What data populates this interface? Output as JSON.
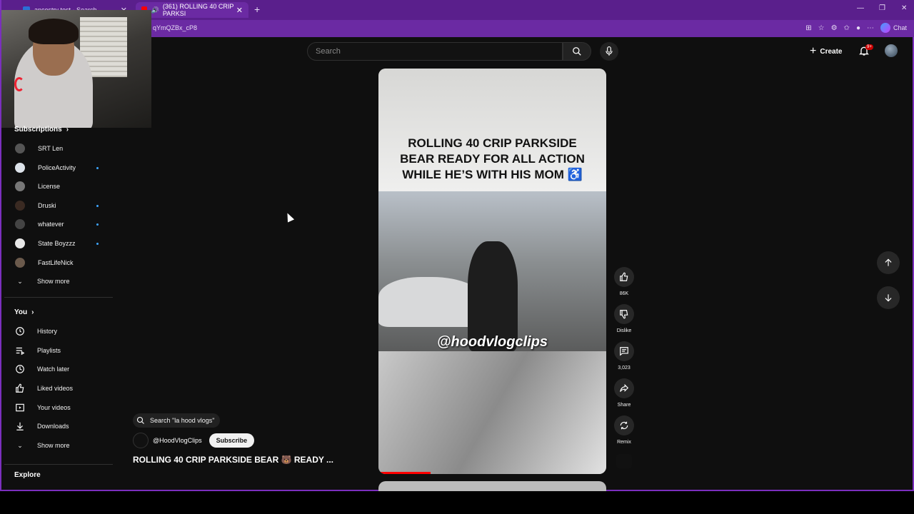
{
  "browser": {
    "tabs": [
      {
        "label": "ancestry test - Search",
        "active": false
      },
      {
        "label": "(361) ROLLING 40 CRIP PARKSI",
        "active": true
      }
    ],
    "url": "qYmQZBx_cP8",
    "chat_label": "Chat"
  },
  "header": {
    "search_placeholder": "Search",
    "create_label": "Create",
    "notification_badge": "9+"
  },
  "sidebar": {
    "subscriptions_title": "Subscriptions",
    "subscriptions": [
      {
        "label": "SRT Len",
        "dot": false,
        "color": "#555"
      },
      {
        "label": "PoliceActivity",
        "dot": true,
        "color": "#dde3ea"
      },
      {
        "label": "License",
        "dot": false,
        "color": "#777"
      },
      {
        "label": "Druski",
        "dot": true,
        "color": "#3a2a22"
      },
      {
        "label": "whatever",
        "dot": true,
        "color": "#444"
      },
      {
        "label": "State Boyzzz",
        "dot": true,
        "color": "#e8e8e8"
      },
      {
        "label": "FastLifeNick",
        "dot": false,
        "color": "#6b5a4c"
      }
    ],
    "subs_show_more": "Show more",
    "you_title": "You",
    "you_items": [
      {
        "label": "History",
        "icon": "history-icon"
      },
      {
        "label": "Playlists",
        "icon": "playlists-icon"
      },
      {
        "label": "Watch later",
        "icon": "watch-later-icon"
      },
      {
        "label": "Liked videos",
        "icon": "thumbs-up-icon"
      },
      {
        "label": "Your videos",
        "icon": "your-videos-icon"
      },
      {
        "label": "Downloads",
        "icon": "download-icon"
      }
    ],
    "you_show_more": "Show more",
    "explore_title": "Explore"
  },
  "video": {
    "caption_lines": [
      "ROLLING 40 CRIP PARKSIDE",
      "BEAR READY FOR ALL ACTION",
      "WHILE HE’S WITH HIS MOM ♿"
    ],
    "watermark": "@hoodvlogclips",
    "progress": 0.23,
    "suggested_search": "Search \"la hood vlogs\"",
    "channel_name": "@HoodVlogClips",
    "subscribe_label": "Subscribe",
    "title": "ROLLING 40 CRIP PARKSIDE BEAR 🐻 READY ..."
  },
  "actions": {
    "like_count": "86K",
    "dislike_label": "Dislike",
    "comment_count": "3,023",
    "share_label": "Share",
    "remix_label": "Remix"
  },
  "colors": {
    "browser_chrome": "#6b2aa3",
    "background": "#0f0f0f",
    "progress": "#ff0000",
    "unread_dot": "#3ea6ff"
  }
}
